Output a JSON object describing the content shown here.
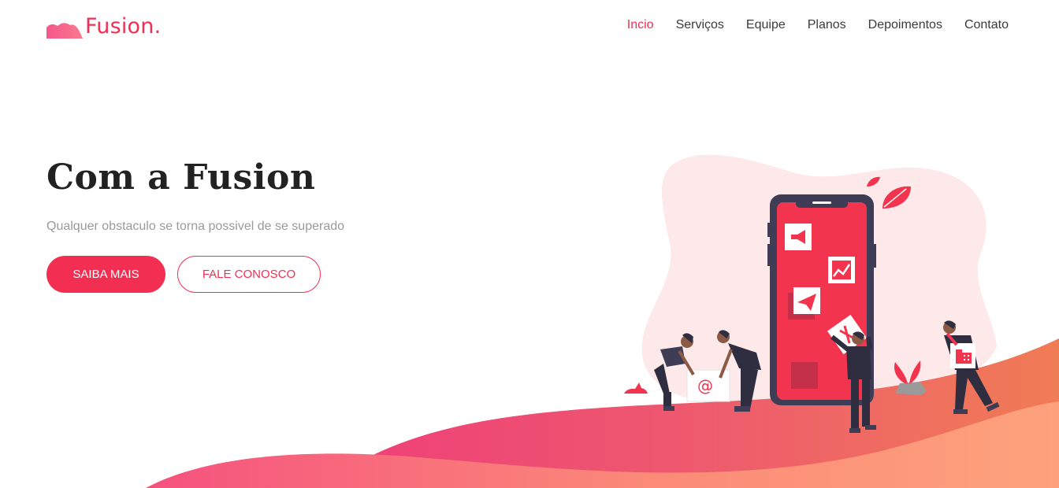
{
  "brand": {
    "name": "Fusion.",
    "logo_icon": "cloud-wave-logo"
  },
  "nav": {
    "items": [
      {
        "label": "Incio",
        "active": true
      },
      {
        "label": "Serviços",
        "active": false
      },
      {
        "label": "Equipe",
        "active": false
      },
      {
        "label": "Planos",
        "active": false
      },
      {
        "label": "Depoimentos",
        "active": false
      },
      {
        "label": "Contato",
        "active": false
      }
    ]
  },
  "hero": {
    "title": "Com a Fusion",
    "subtitle": "Qualquer obstaculo se torna possivel de se superado",
    "primary_button": "SAIBA MAIS",
    "secondary_button": "FALE CONOSCO"
  },
  "colors": {
    "accent": "#f22f53",
    "blob": "#fde8ea",
    "phone_frame": "#3f3d56",
    "wave_pink": "#f0467f",
    "wave_orange": "#fba07a"
  },
  "illustration": {
    "icons": [
      "megaphone-icon",
      "chart-icon",
      "paper-plane-icon",
      "at-sign-icon",
      "building-icon",
      "leaf-icon"
    ]
  }
}
